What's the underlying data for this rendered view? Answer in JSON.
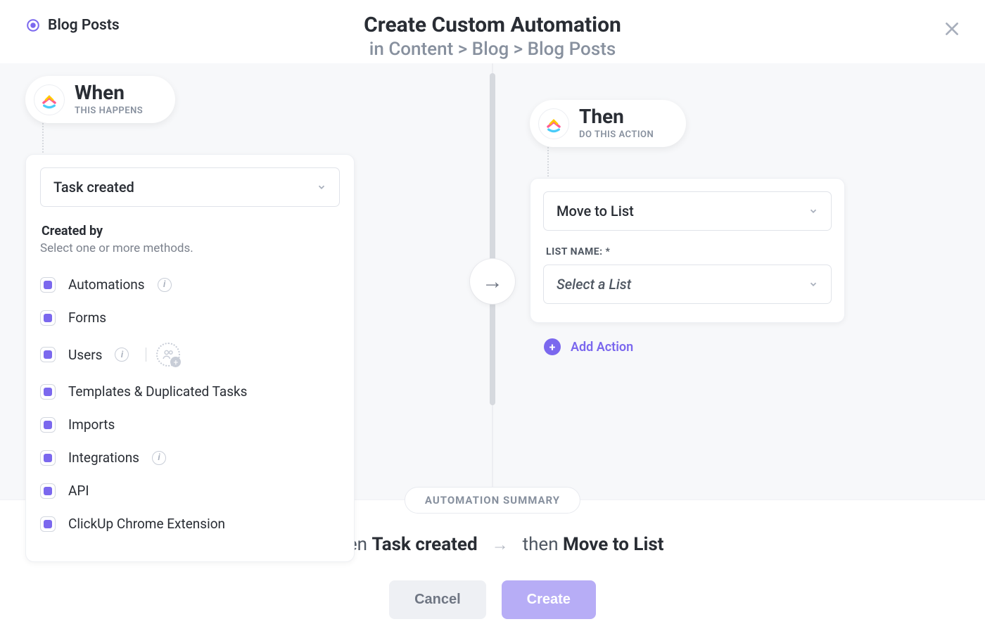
{
  "location": {
    "label": "Blog Posts"
  },
  "header": {
    "title": "Create Custom Automation",
    "breadcrumb_prefix": "in ",
    "breadcrumb": "Content > Blog > Blog Posts"
  },
  "when": {
    "title": "When",
    "subtitle": "THIS HAPPENS",
    "trigger_selected": "Task created",
    "created_by_label": "Created by",
    "created_by_help": "Select one or more methods.",
    "methods": [
      {
        "label": "Automations",
        "info": true,
        "users": false
      },
      {
        "label": "Forms",
        "info": false,
        "users": false
      },
      {
        "label": "Users",
        "info": true,
        "users": true
      },
      {
        "label": "Templates & Duplicated Tasks",
        "info": false,
        "users": false
      },
      {
        "label": "Imports",
        "info": false,
        "users": false
      },
      {
        "label": "Integrations",
        "info": true,
        "users": false
      },
      {
        "label": "API",
        "info": false,
        "users": false
      },
      {
        "label": "ClickUp Chrome Extension",
        "info": false,
        "users": false
      }
    ]
  },
  "then": {
    "title": "Then",
    "subtitle": "DO THIS ACTION",
    "action_selected": "Move to List",
    "list_name_label": "LIST NAME: *",
    "list_placeholder": "Select a List",
    "add_action_label": "Add Action"
  },
  "summary": {
    "badge": "AUTOMATION SUMMARY",
    "when_word": "When",
    "when_value": "Task created",
    "then_word": "then",
    "then_value": "Move to List"
  },
  "buttons": {
    "cancel": "Cancel",
    "create": "Create"
  }
}
